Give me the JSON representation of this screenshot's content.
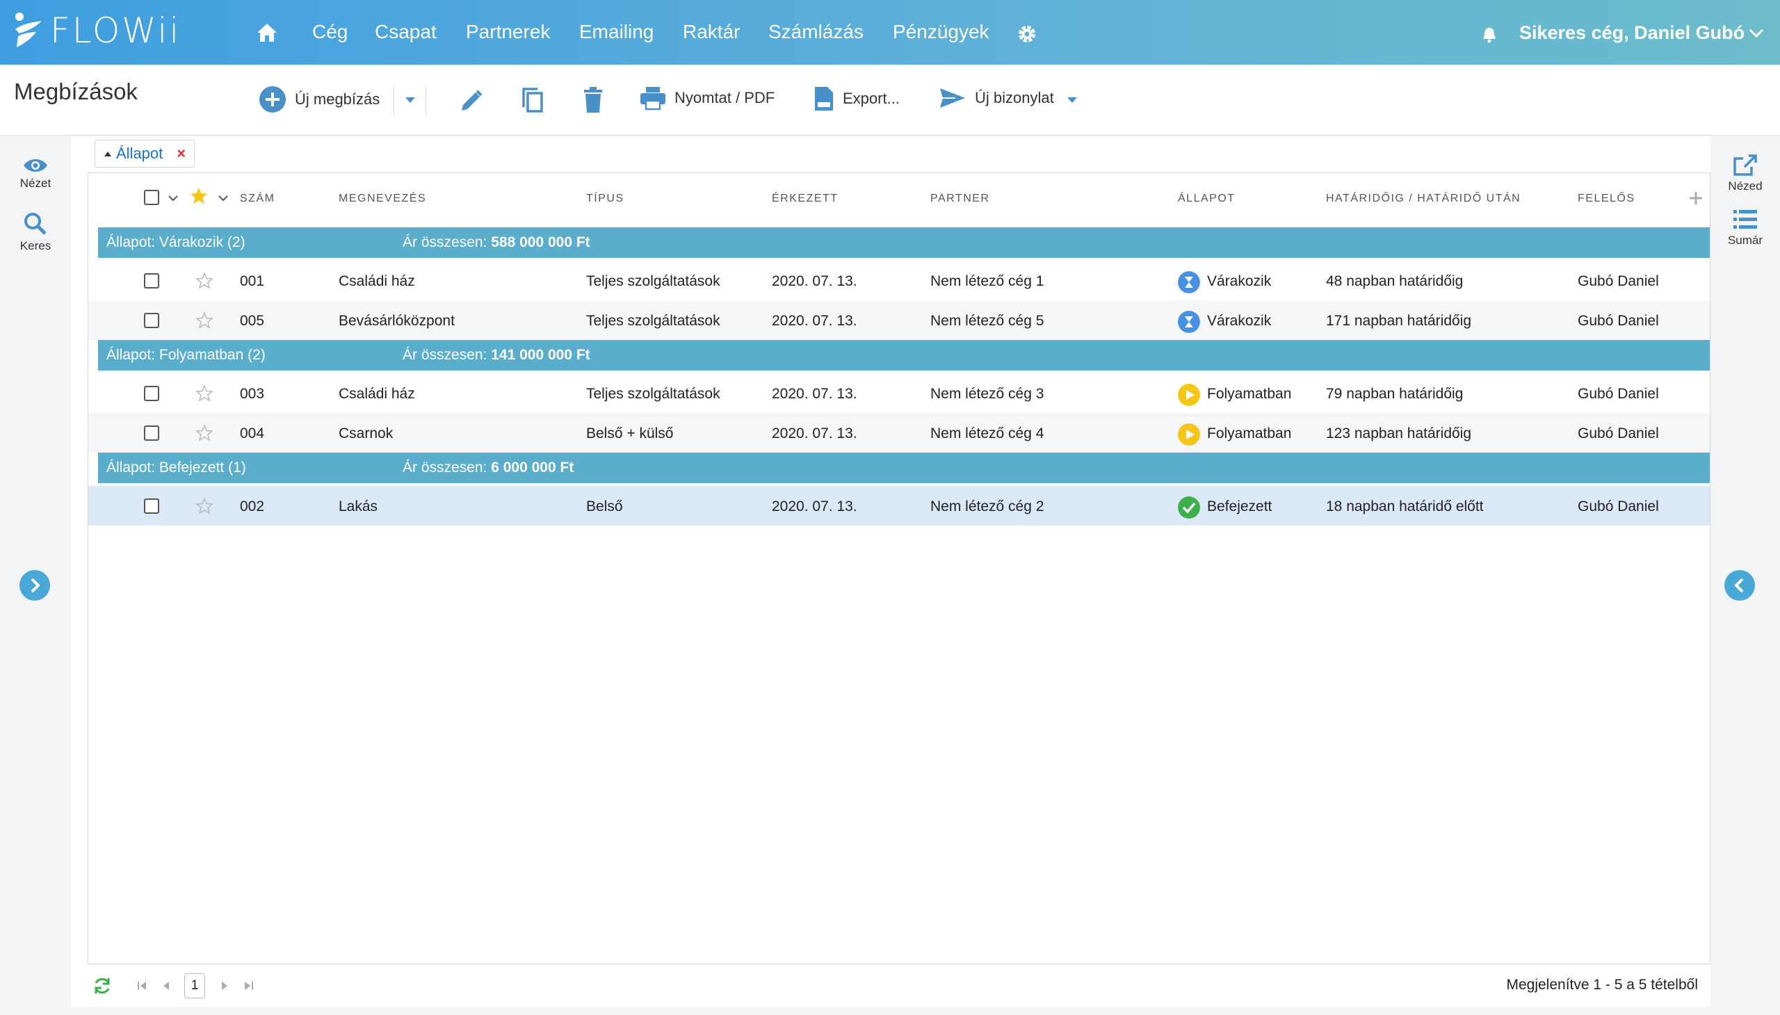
{
  "app": {
    "logo_text": "FLOWii"
  },
  "nav": {
    "items": [
      "Cég",
      "Csapat",
      "Partnerek",
      "Emailing",
      "Raktár",
      "Számlázás",
      "Pénzügyek"
    ],
    "user": "Sikeres cég, Daniel Gubó"
  },
  "toolbar": {
    "page_title": "Megbízások",
    "new_label": "Új megbízás",
    "print_label": "Nyomtat / PDF",
    "export_label": "Export...",
    "new_doc_label": "Új bizonylat"
  },
  "left_side": {
    "view_label": "Nézet",
    "search_label": "Keres"
  },
  "right_side": {
    "view_label": "Nézed",
    "summary_label": "Sumár"
  },
  "filter": {
    "chip_label": "Állapot",
    "remove": "×"
  },
  "columns": [
    "SZÁM",
    "MEGNEVEZÉS",
    "TÍPUS",
    "ÉRKEZETT",
    "PARTNER",
    "ÁLLAPOT",
    "HATÁRIDŐIG / HATÁRIDŐ UTÁN",
    "FELELŐS"
  ],
  "groups": [
    {
      "title": "Állapot: Várakozik (2)",
      "sum_label": "Ár összesen:",
      "sum_value": "588 000 000 Ft"
    },
    {
      "title": "Állapot: Folyamatban (2)",
      "sum_label": "Ár összesen:",
      "sum_value": "141 000 000 Ft"
    },
    {
      "title": "Állapot: Befejezett (1)",
      "sum_label": "Ár összesen:",
      "sum_value": "6 000 000 Ft"
    }
  ],
  "rows": [
    {
      "num": "001",
      "name": "Családi ház",
      "type": "Teljes szolgáltatások",
      "date": "2020. 07. 13.",
      "partner": "Nem létező cég 1",
      "status": "Várakozik",
      "deadline": "48 napban határidőig",
      "owner": "Gubó Daniel"
    },
    {
      "num": "005",
      "name": "Bevásárlóközpont",
      "type": "Teljes szolgáltatások",
      "date": "2020. 07. 13.",
      "partner": "Nem létező cég 5",
      "status": "Várakozik",
      "deadline": "171 napban határidőig",
      "owner": "Gubó Daniel"
    },
    {
      "num": "003",
      "name": "Családi ház",
      "type": "Teljes szolgáltatások",
      "date": "2020. 07. 13.",
      "partner": "Nem létező cég 3",
      "status": "Folyamatban",
      "deadline": "79 napban határidőig",
      "owner": "Gubó Daniel"
    },
    {
      "num": "004",
      "name": "Csarnok",
      "type": "Belső + külső",
      "date": "2020. 07. 13.",
      "partner": "Nem létező cég 4",
      "status": "Folyamatban",
      "deadline": "123 napban határidőig",
      "owner": "Gubó Daniel"
    },
    {
      "num": "002",
      "name": "Lakás",
      "type": "Belső",
      "date": "2020. 07. 13.",
      "partner": "Nem létező cég 2",
      "status": "Befejezett",
      "deadline": "18 napban határidő előtt",
      "owner": "Gubó Daniel"
    }
  ],
  "footer": {
    "page": "1",
    "info": "Megjelenítve 1 - 5 a 5 tételből"
  },
  "colors": {
    "accent": "#4aa8d8",
    "group_bar": "#5aaecc",
    "waiting": "#4a90e2",
    "in_progress": "#f5c518",
    "done": "#3cae4a",
    "selected_row": "#dbe9f6"
  }
}
